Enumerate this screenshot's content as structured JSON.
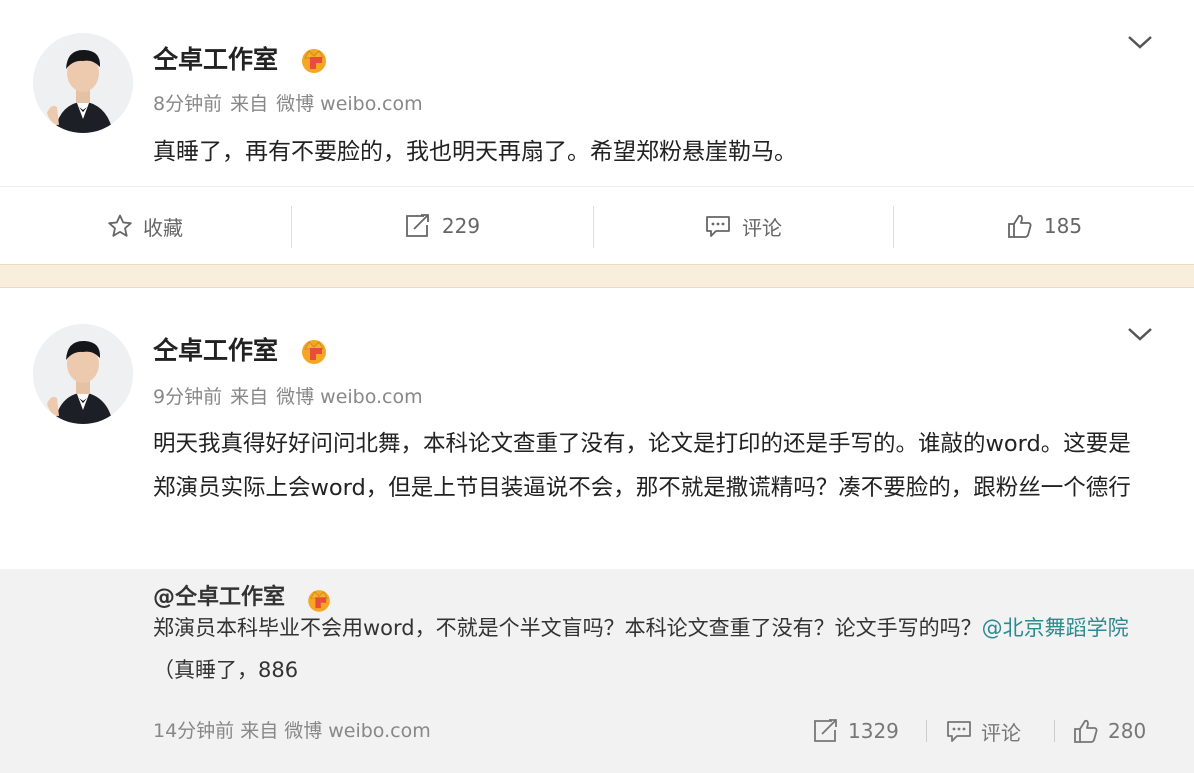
{
  "posts": [
    {
      "username": "仝卓工作室",
      "time": "8分钟前",
      "source_prefix": "来自",
      "source": "微博 weibo.com",
      "content": "真睡了，再有不要脸的，我也明天再扇了。希望郑粉悬崖勒马。",
      "actions": {
        "favorite_label": "收藏",
        "repost_count": "229",
        "comment_label": "评论",
        "like_count": "185"
      }
    },
    {
      "username": "仝卓工作室",
      "time": "9分钟前",
      "source_prefix": "来自",
      "source": "微博 weibo.com",
      "content": "明天我真得好好问问北舞，本科论文查重了没有，论文是打印的还是手写的。谁敲的word。这要是郑演员实际上会word，但是上节目装逼说不会，那不就是撒谎精吗？凑不要脸的，跟粉丝一个德行",
      "repost": {
        "username": "@仝卓工作室",
        "text": "郑演员本科毕业不会用word，不就是个半文盲吗？本科论文查重了没有？论文手写的吗？",
        "mention": "@北京舞蹈学院",
        "text_after": " （真睡了，886",
        "time": "14分钟前",
        "source_prefix": "来自",
        "source": "微博 weibo.com",
        "repost_count": "1329",
        "comment_label": "评论",
        "like_count": "280"
      }
    }
  ],
  "colors": {
    "link": "#2d8a8f",
    "band": "#f7eedc",
    "repost_bg": "#f2f2f2",
    "vip": "#f5a623"
  },
  "icons": [
    "avatar",
    "vip-crown-icon",
    "chevron-down-icon",
    "star-icon",
    "repost-icon",
    "comment-icon",
    "like-icon"
  ]
}
